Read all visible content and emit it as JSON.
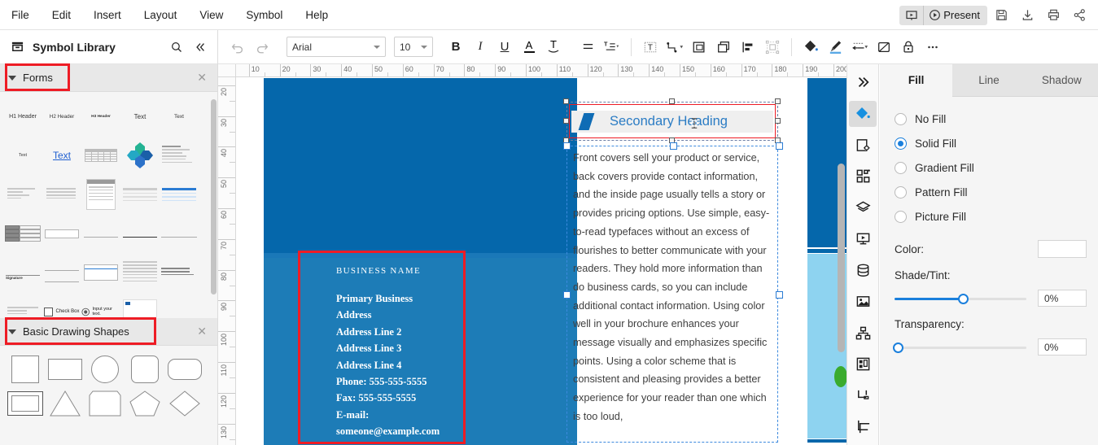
{
  "menu": {
    "items": [
      "File",
      "Edit",
      "Insert",
      "Layout",
      "View",
      "Symbol",
      "Help"
    ],
    "present_label": "Present"
  },
  "header_icons": [
    {
      "name": "presentation-mode-icon"
    },
    {
      "name": "save-icon"
    },
    {
      "name": "download-icon"
    },
    {
      "name": "print-icon"
    },
    {
      "name": "share-icon"
    }
  ],
  "sidebar": {
    "title": "Symbol Library",
    "search_icon": "search-icon",
    "collapse_icon": "double-chevron-left-icon",
    "panels": [
      {
        "title": "Forms",
        "highlighted": true
      },
      {
        "title": "Basic Drawing Shapes",
        "highlighted": true
      }
    ],
    "forms_labels": [
      "H1 Header",
      "H2 Header",
      "H3 Header",
      "Text",
      "Text",
      "Text",
      "Text"
    ],
    "checkbox_label": "Check Box",
    "input_label": "Input your text."
  },
  "toolbar": {
    "undo_icon": "undo-icon",
    "redo_icon": "redo-icon",
    "font_family": "Arial",
    "font_size": "10",
    "bold_label": "B",
    "italic_label": "I",
    "underline_label": "U",
    "font_color_label": "A",
    "text_effect_label": "T",
    "icons": [
      "align-left-icon",
      "line-spacing-icon",
      "text-box-icon",
      "connector-icon",
      "group-icon",
      "duplicate-icon",
      "align-objects-icon",
      "select-all-icon",
      "fill-color-icon",
      "brush-icon",
      "line-style-icon",
      "shape-format-icon",
      "lock-icon",
      "more-options-icon"
    ]
  },
  "canvas": {
    "ruler_h_labels": [
      "10",
      "20",
      "30",
      "40",
      "50",
      "60",
      "70",
      "80",
      "90",
      "100",
      "110",
      "120",
      "130",
      "140",
      "150",
      "160",
      "170",
      "180",
      "190",
      "200"
    ],
    "ruler_v_labels": [
      "20",
      "30",
      "40",
      "50",
      "60",
      "70",
      "80",
      "90",
      "100",
      "110",
      "120",
      "130"
    ],
    "business_card": {
      "name": "BUSINESS NAME",
      "lines": [
        "Primary Business",
        "Address",
        "Address Line 2",
        "Address Line 3",
        "Address Line 4",
        "Phone: 555-555-5555",
        "Fax: 555-555-5555",
        "E-mail:",
        "someone@example.com"
      ]
    },
    "heading": "Secondary Heading",
    "body_text": "Front covers sell your product or service, back covers provide contact information, and the inside page usually tells a story or provides pricing options. Use simple, easy-to-read typefaces without an excess of flourishes to better communicate with your readers. They hold more information than do business cards, so you can include additional contact information. Using color well in your brochure enhances your message visually and emphasizes specific points. Using a color scheme that is consistent and pleasing provides a better experience for your reader than one which is too loud,",
    "colors": {
      "dark_blue": "#0567ab",
      "mid_blue": "#1d7cb7",
      "light_blue": "#8ed3f0",
      "green": "#3aab2e",
      "selection_red": "#ee1c25",
      "selection_blue": "#2b7cd3"
    }
  },
  "rail_icons": [
    "expand-panel-icon",
    "fill-color-icon",
    "page-setup-icon",
    "symbols-icon",
    "layers-icon",
    "slideshow-icon",
    "data-icon",
    "image-icon",
    "org-chart-icon",
    "template-icon",
    "callout-icon",
    "crop-icon"
  ],
  "rpanel": {
    "tabs": [
      {
        "label": "Fill",
        "active": true
      },
      {
        "label": "Line",
        "active": false
      },
      {
        "label": "Shadow",
        "active": false
      }
    ],
    "fill_options": [
      {
        "label": "No Fill",
        "selected": false
      },
      {
        "label": "Solid Fill",
        "selected": true
      },
      {
        "label": "Gradient Fill",
        "selected": false
      },
      {
        "label": "Pattern Fill",
        "selected": false
      },
      {
        "label": "Picture Fill",
        "selected": false
      }
    ],
    "color_label": "Color:",
    "color_value": "#ffffff",
    "shade_label": "Shade/Tint:",
    "shade_value": "0%",
    "shade_knob_pct": 52,
    "transparency_label": "Transparency:",
    "transparency_value": "0%",
    "transparency_knob_pct": 0
  }
}
